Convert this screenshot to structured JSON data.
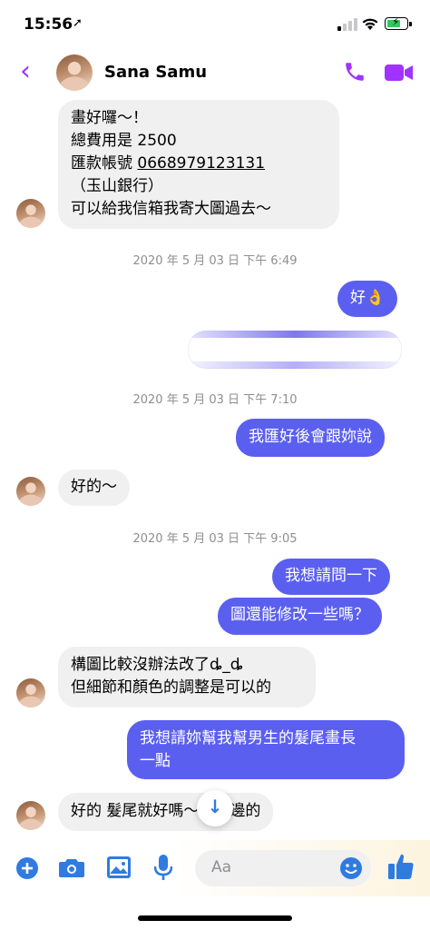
{
  "status_bar": {
    "time": "15:56",
    "location_arrow": "➚"
  },
  "header": {
    "contact_name": "Sana Samu",
    "back_glyph": "‹"
  },
  "messages": {
    "m1": "畫好囉～！\n總費用是 2500\n匯款帳號 ",
    "m1_account": "0668979123131",
    "m1_rest": "\n（玉山銀行）\n可以給我信箱我寄大圖過去～",
    "ts1": "2020 年 5 月 03 日 下午 6:49",
    "m2": "好👌",
    "ts2": "2020 年 5 月 03 日 下午 7:10",
    "m3": "我匯好後會跟妳說",
    "m4": "好的～",
    "ts3": "2020 年 5 月 03 日 下午 9:05",
    "m5": "我想請問一下",
    "m6": "圖還能修改一些嗎？",
    "m7": "構圖比較沒辦法改了ȡ_ȡ\n但細節和顏色的調整是可以的",
    "m8": "我想請妳幫我幫男生的髮尾畫長\n一點",
    "m9": "好的 髮尾就好嗎～子那邊的"
  },
  "composer": {
    "placeholder": "Aa"
  },
  "colors": {
    "accent": "#a033ff",
    "outgoing": "#5b5ff0",
    "blue_icon": "#2f7be0"
  }
}
